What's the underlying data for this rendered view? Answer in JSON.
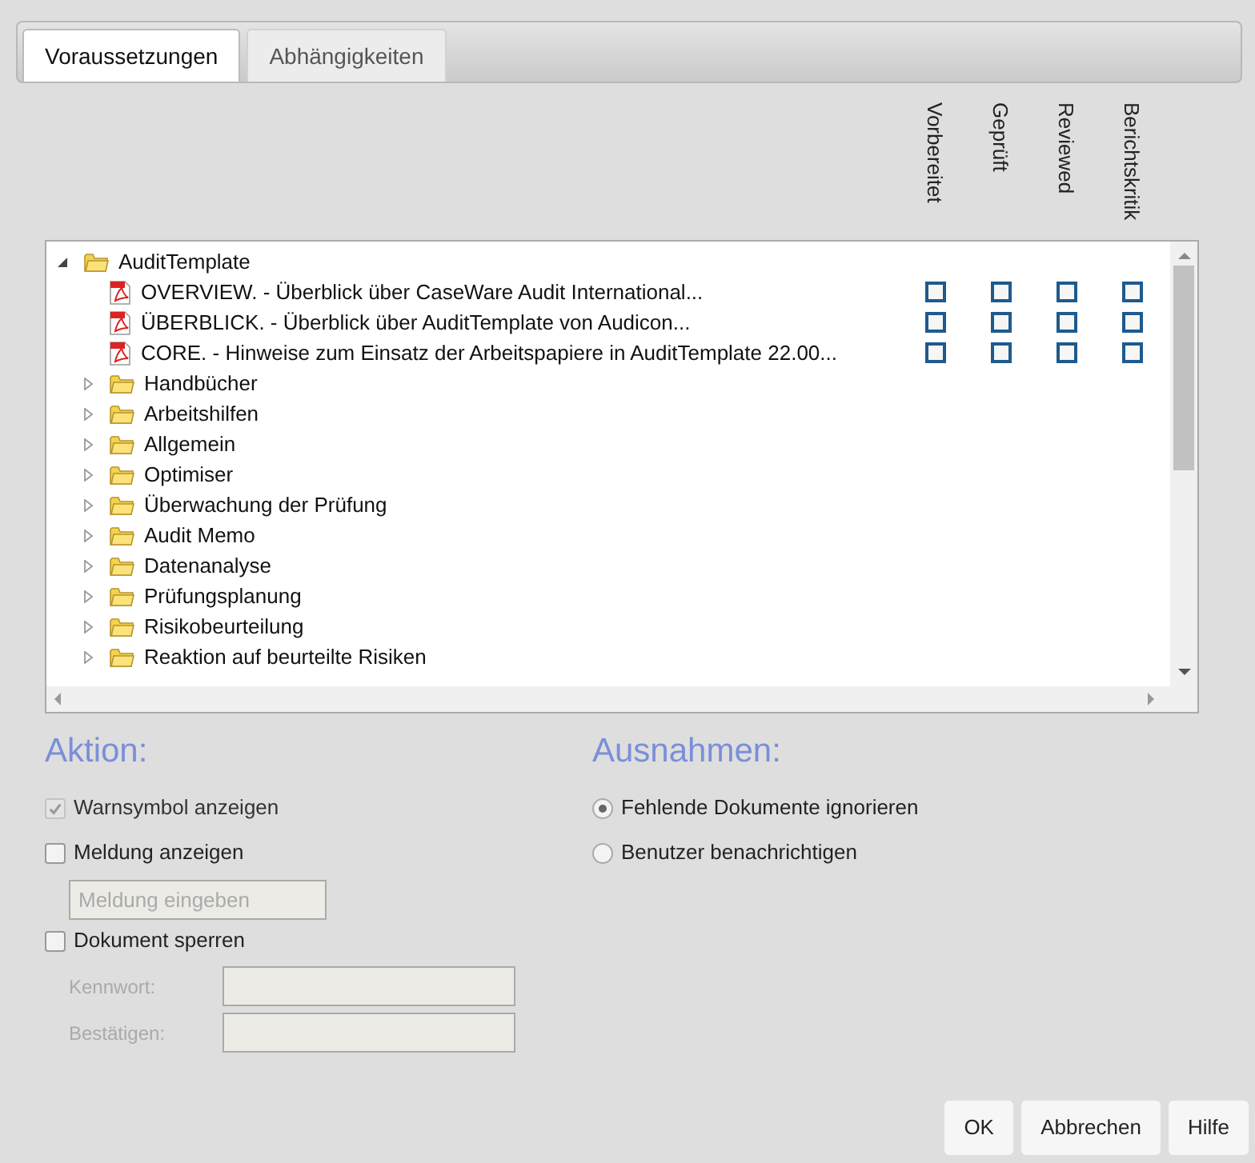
{
  "tabs": [
    {
      "label": "Voraussetzungen",
      "selected": true
    },
    {
      "label": "Abhängigkeiten",
      "selected": false
    }
  ],
  "columns": [
    "Vorbereitet",
    "Geprüft",
    "Reviewed",
    "Berichtskritik"
  ],
  "tree": [
    {
      "kind": "folder",
      "label": "AuditTemplate",
      "expanded": true,
      "children": [
        {
          "kind": "pdf",
          "label": "OVERVIEW. - Überblick über CaseWare Audit International...",
          "checks": [
            false,
            false,
            false,
            false
          ]
        },
        {
          "kind": "pdf",
          "label": "ÜBERBLICK. - Überblick über AuditTemplate von Audicon...",
          "checks": [
            false,
            false,
            false,
            false
          ]
        },
        {
          "kind": "pdf",
          "label": "CORE. - Hinweise zum Einsatz der Arbeitspapiere in AuditTemplate 22.00...",
          "checks": [
            false,
            false,
            false,
            false
          ]
        },
        {
          "kind": "folder",
          "label": "Handbücher",
          "expanded": false
        },
        {
          "kind": "folder",
          "label": "Arbeitshilfen",
          "expanded": false
        },
        {
          "kind": "folder",
          "label": "Allgemein",
          "expanded": false
        },
        {
          "kind": "folder",
          "label": "Optimiser",
          "expanded": false
        },
        {
          "kind": "folder",
          "label": "Überwachung der Prüfung",
          "expanded": false
        },
        {
          "kind": "folder",
          "label": "Audit Memo",
          "expanded": false
        },
        {
          "kind": "folder",
          "label": "Datenanalyse",
          "expanded": false
        },
        {
          "kind": "folder",
          "label": "Prüfungsplanung",
          "expanded": false
        },
        {
          "kind": "folder",
          "label": "Risikobeurteilung",
          "expanded": false
        },
        {
          "kind": "folder",
          "label": "Reaktion auf beurteilte Risiken",
          "expanded": false
        }
      ]
    }
  ],
  "action": {
    "title": "Aktion:",
    "options": [
      {
        "label": "Warnsymbol anzeigen",
        "checked": true,
        "disabled": true
      },
      {
        "label": "Meldung anzeigen",
        "checked": false,
        "disabled": false
      }
    ],
    "message_field": {
      "placeholder": "Meldung eingeben"
    },
    "lock": {
      "label": "Dokument sperren",
      "checked": false
    },
    "password_fields": [
      {
        "label": "Kennwort:"
      },
      {
        "label": "Bestätigen:"
      }
    ]
  },
  "exceptions": {
    "title": "Ausnahmen:",
    "options": [
      {
        "label": "Fehlende Dokumente ignorieren",
        "selected": true
      },
      {
        "label": "Benutzer benachrichtigen",
        "selected": false
      }
    ]
  },
  "buttons": [
    "OK",
    "Abbrechen",
    "Hilfe"
  ]
}
